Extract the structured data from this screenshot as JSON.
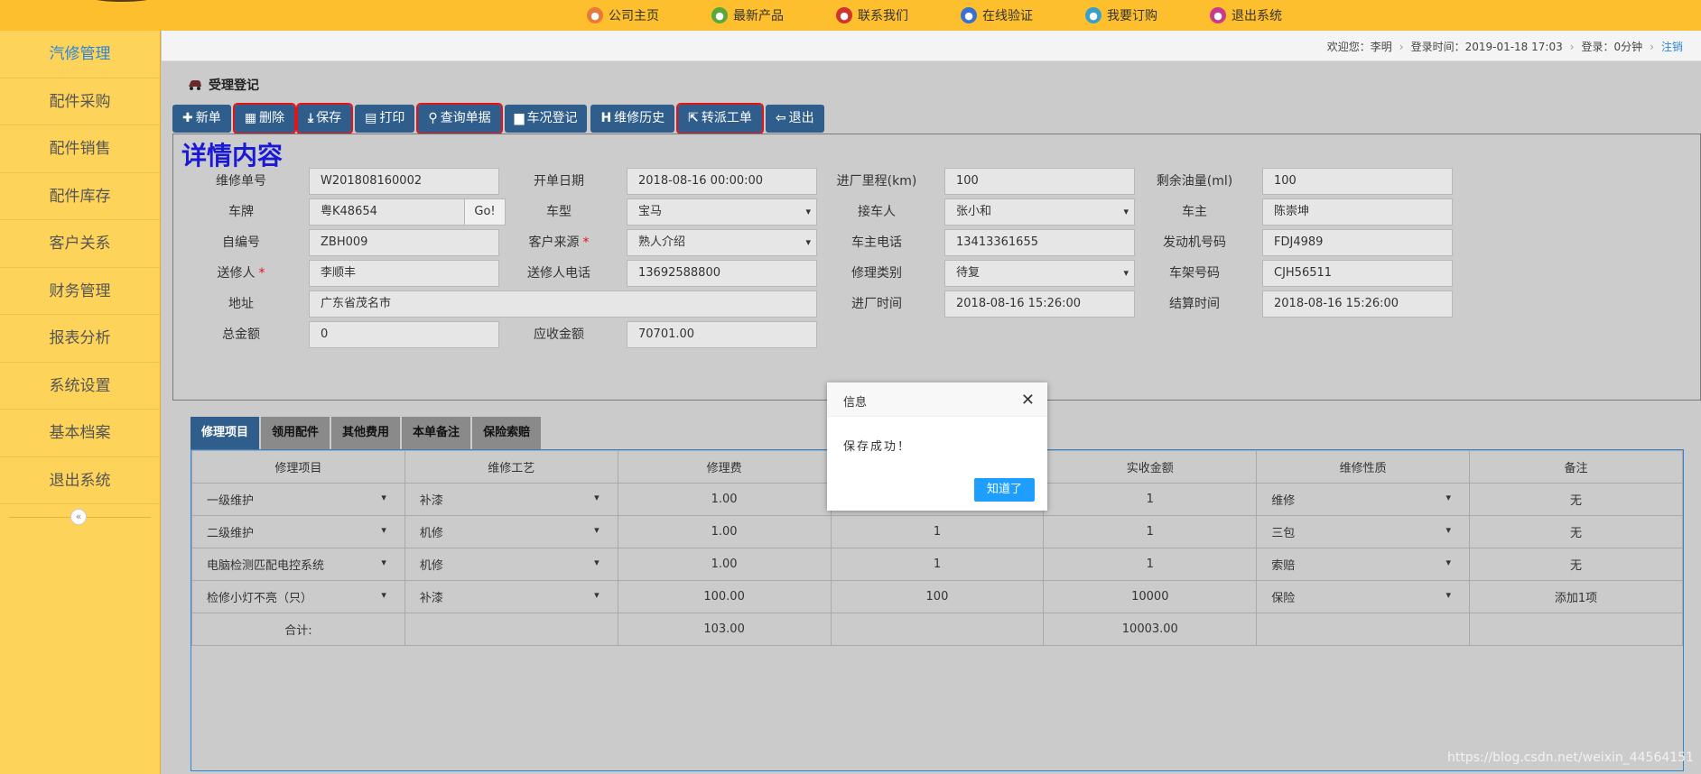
{
  "topnav": [
    {
      "label": "公司主页",
      "icon": "home-icon",
      "color": "#e8793a"
    },
    {
      "label": "最新产品",
      "icon": "product-icon",
      "color": "#5aa83a"
    },
    {
      "label": "联系我们",
      "icon": "contact-icon",
      "color": "#d0342c"
    },
    {
      "label": "在线验证",
      "icon": "verify-icon",
      "color": "#3b6fd0"
    },
    {
      "label": "我要订购",
      "icon": "order-icon",
      "color": "#3aa0c8"
    },
    {
      "label": "退出系统",
      "icon": "exit-icon",
      "color": "#c83a8a"
    }
  ],
  "sidebar": {
    "items": [
      "汽修管理",
      "配件采购",
      "配件销售",
      "配件库存",
      "客户关系",
      "财务管理",
      "报表分析",
      "系统设置",
      "基本档案",
      "退出系统"
    ],
    "collapse": "«"
  },
  "userbar": {
    "welcome": "欢迎您：李明",
    "login_time": "登录时间：2019-01-18 17:03",
    "duration": "登录：0分钟",
    "logout": "注销"
  },
  "page": {
    "title": "受理登记"
  },
  "toolbar": [
    {
      "label": "新单",
      "glyph": "✚",
      "highlight": false
    },
    {
      "label": "删除",
      "glyph": "▦",
      "highlight": true
    },
    {
      "label": "保存",
      "glyph": "⤓",
      "highlight": true
    },
    {
      "label": "打印",
      "glyph": "▤",
      "highlight": false
    },
    {
      "label": "查询单据",
      "glyph": "⚲",
      "highlight": true
    },
    {
      "label": "车况登记",
      "glyph": "▆",
      "highlight": false
    },
    {
      "label": "维修历史",
      "glyph": "H",
      "highlight": false
    },
    {
      "label": "转派工单",
      "glyph": "⇱",
      "highlight": true
    },
    {
      "label": "退出",
      "glyph": "⇦",
      "highlight": false
    }
  ],
  "detail": {
    "heading": "详情内容",
    "fields": {
      "order_no": {
        "label": "维修单号",
        "value": "W201808160002"
      },
      "open_date": {
        "label": "开单日期",
        "value": "2018-08-16 00:00:00"
      },
      "mileage": {
        "label": "进厂里程(km)",
        "value": "100"
      },
      "fuel": {
        "label": "剩余油量(ml)",
        "value": "100"
      },
      "plate": {
        "label": "车牌",
        "value": "粤K48654",
        "go": "Go!"
      },
      "model": {
        "label": "车型",
        "value": "宝马"
      },
      "receiver": {
        "label": "接车人",
        "value": "张小和"
      },
      "owner": {
        "label": "车主",
        "value": "陈崇坤"
      },
      "self_no": {
        "label": "自编号",
        "value": "ZBH009"
      },
      "source": {
        "label": "客户来源",
        "value": "熟人介绍",
        "required": "*"
      },
      "owner_phone": {
        "label": "车主电话",
        "value": "13413361655"
      },
      "engine_no": {
        "label": "发动机号码",
        "value": "FDJ4989"
      },
      "sender": {
        "label": "送修人",
        "value": "李顺丰",
        "required": "*"
      },
      "sender_phone": {
        "label": "送修人电话",
        "value": "13692588800"
      },
      "repair_type": {
        "label": "修理类别",
        "value": "待复"
      },
      "frame_no": {
        "label": "车架号码",
        "value": "CJH56511"
      },
      "address": {
        "label": "地址",
        "value": "广东省茂名市"
      },
      "entry_time": {
        "label": "进厂时间",
        "value": "2018-08-16 15:26:00"
      },
      "settle_time": {
        "label": "结算时间",
        "value": "2018-08-16 15:26:00"
      },
      "total": {
        "label": "总金额",
        "value": "0"
      },
      "receivable": {
        "label": "应收金额",
        "value": "70701.00"
      }
    }
  },
  "tabs": [
    "修理项目",
    "领用配件",
    "其他费用",
    "本单备注",
    "保险索赔"
  ],
  "grid": {
    "headers": [
      "修理项目",
      "维修工艺",
      "修理费",
      "",
      "实收金额",
      "维修性质",
      "备注"
    ],
    "rows": [
      [
        "一级维护",
        "补漆",
        "1.00",
        "",
        "1",
        "维修",
        "无"
      ],
      [
        "二级维护",
        "机修",
        "1.00",
        "1",
        "1",
        "三包",
        "无"
      ],
      [
        "电脑检测匹配电控系统",
        "机修",
        "1.00",
        "1",
        "1",
        "索赔",
        "无"
      ],
      [
        "检修小灯不亮（只）",
        "补漆",
        "100.00",
        "100",
        "10000",
        "保险",
        "添加1项"
      ]
    ],
    "total_row": [
      "合计:",
      "",
      "103.00",
      "",
      "10003.00",
      "",
      ""
    ]
  },
  "modal": {
    "title": "信息",
    "message": "保存成功！",
    "ok": "知道了",
    "close": "✕"
  },
  "watermark": "https://blog.csdn.net/weixin_44564151"
}
